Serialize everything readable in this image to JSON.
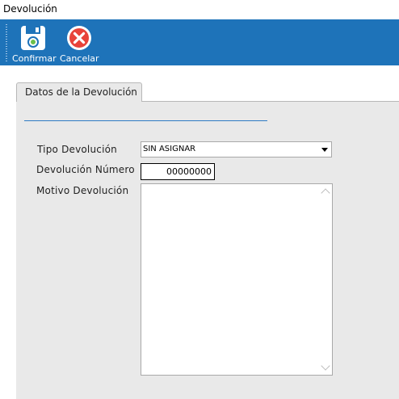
{
  "window": {
    "title": "Devolución"
  },
  "toolbar": {
    "confirm_label": "Confirmar",
    "confirm_icon": "floppy-disk-icon",
    "cancel_label": "Cancelar",
    "cancel_icon": "cancel-x-icon",
    "background_color": "#1e73b9"
  },
  "tabs": [
    {
      "label": "Datos de la Devolución",
      "active": true
    }
  ],
  "form": {
    "tipo_label": "Tipo Devolución",
    "tipo_value": "SIN ASIGNAR",
    "numero_label": "Devolución Número",
    "numero_value": "00000000",
    "motivo_label": "Motivo Devolución",
    "motivo_value": ""
  }
}
